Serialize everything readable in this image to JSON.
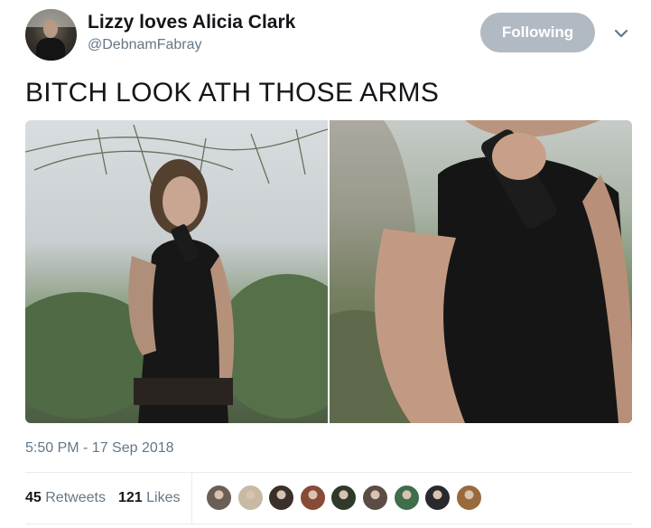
{
  "tweet": {
    "display_name": "Lizzy loves Alicia Clark",
    "handle": "@DebnamFabray",
    "follow_label": "Following",
    "text": "BITCH LOOK ATH THOSE ARMS",
    "timestamp": "5:50 PM - 17 Sep 2018"
  },
  "stats": {
    "retweets_count": "45",
    "retweets_label": "Retweets",
    "likes_count": "121",
    "likes_label": "Likes"
  },
  "likers": [
    {
      "color": "#6b5e55"
    },
    {
      "color": "#c7b9a3"
    },
    {
      "color": "#3a2f2b"
    },
    {
      "color": "#8a4a38"
    },
    {
      "color": "#2f3a2a"
    },
    {
      "color": "#5b4d46"
    },
    {
      "color": "#3e6e4c"
    },
    {
      "color": "#2a2a2e"
    },
    {
      "color": "#9a6a3c"
    }
  ],
  "colors": {
    "follow_button_bg": "#b1bac3",
    "secondary_text": "#657786",
    "primary_text": "#14171a"
  },
  "icons": {
    "caret": "chevron-down-icon"
  }
}
